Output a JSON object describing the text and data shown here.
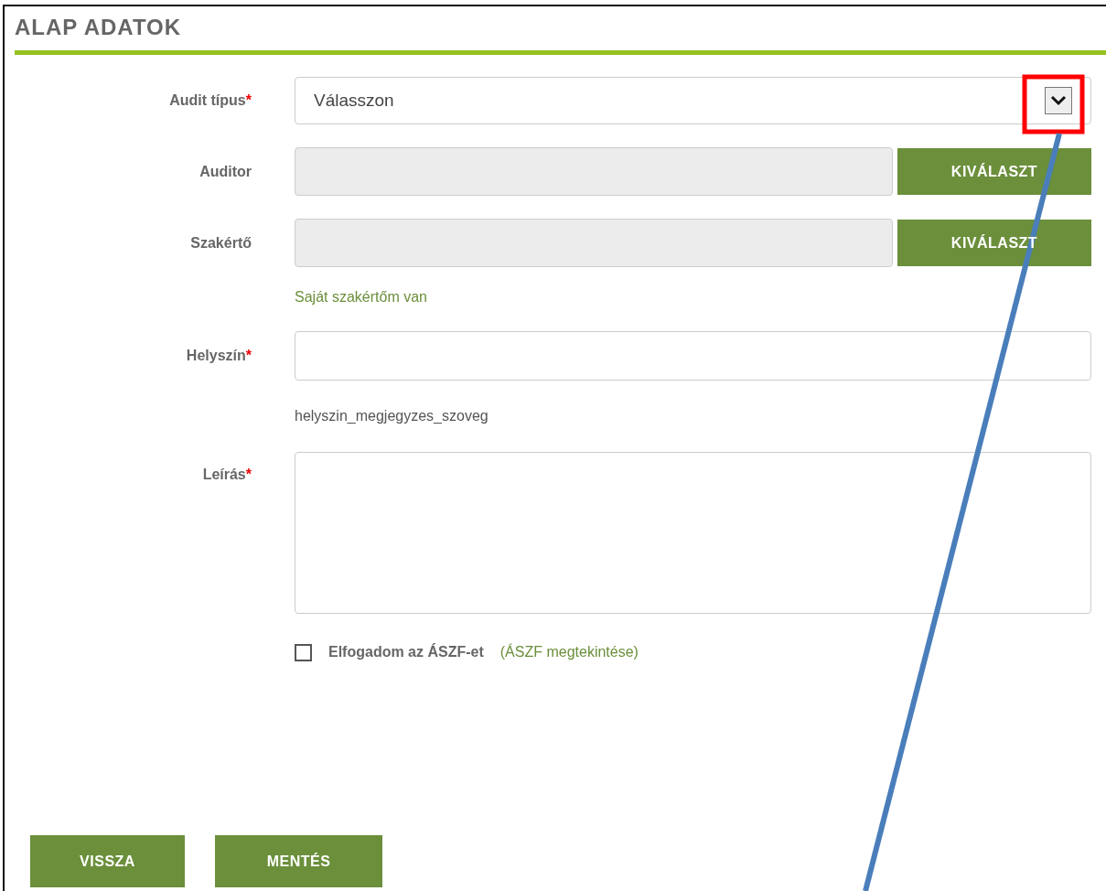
{
  "section": {
    "title": "ALAP ADATOK"
  },
  "rows": [
    {
      "kind": "select",
      "label": "Audit típus",
      "required_mark": "*",
      "value": "Válasszon"
    },
    {
      "kind": "picker",
      "label": "Auditor",
      "disabled": true,
      "button": "KIVÁLASZT"
    },
    {
      "kind": "picker",
      "label": "Szakértő",
      "disabled": true,
      "button": "KIVÁLASZT"
    },
    {
      "kind": "link",
      "text": "Saját szakértőm van"
    },
    {
      "kind": "text",
      "label": "Helyszín",
      "required_mark": "*"
    },
    {
      "kind": "note",
      "text": "helyszin_megjegyzes_szoveg"
    },
    {
      "kind": "textarea",
      "label": "Leírás",
      "required_mark": "*"
    },
    {
      "kind": "checkbox",
      "label": "Elfogadom az ÁSZF-et",
      "checked": false,
      "link": "(ÁSZF megtekintése)"
    }
  ],
  "buttons": [
    "VISSZA",
    "MENTÉS"
  ]
}
